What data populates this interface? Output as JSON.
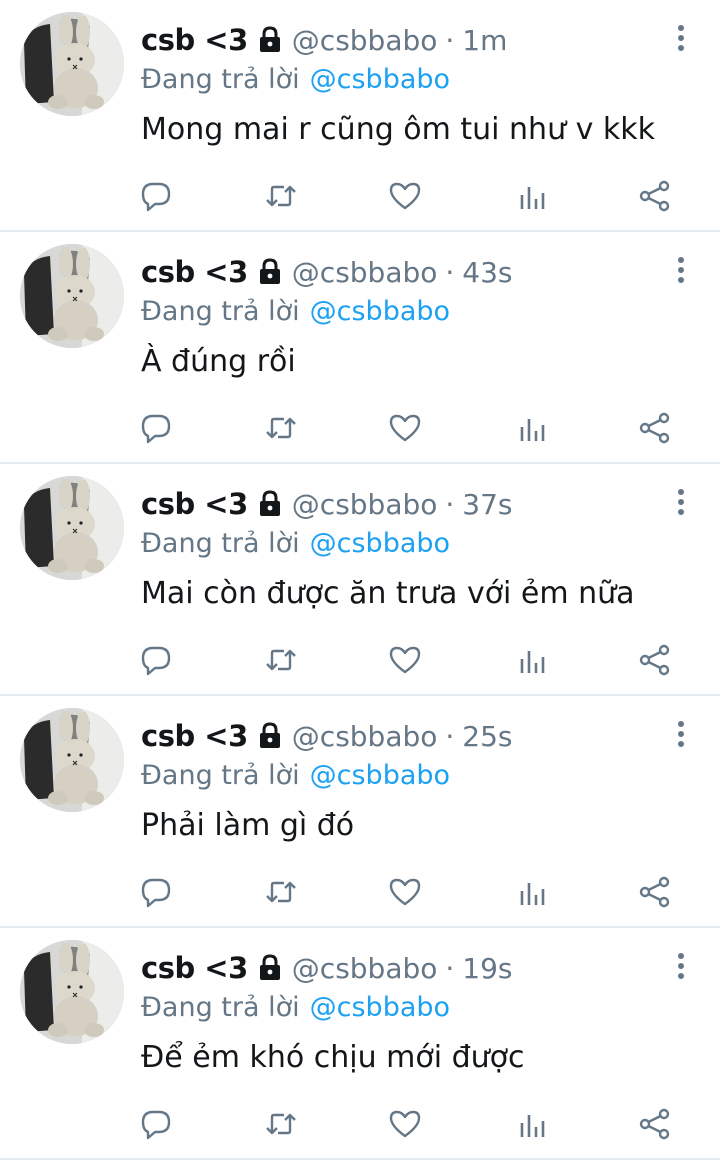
{
  "feed": {
    "tweets": [
      {
        "display_name": "csb <3",
        "handle": "@csbbabo",
        "separator": "·",
        "time": "1m",
        "reply_prefix": "Đang trả lời",
        "reply_target": "@csbbabo",
        "text": "Mong mai r cũng ôm tui như v kkk"
      },
      {
        "display_name": "csb <3",
        "handle": "@csbbabo",
        "separator": "·",
        "time": "43s",
        "reply_prefix": "Đang trả lời",
        "reply_target": "@csbbabo",
        "text": "À đúng rồi"
      },
      {
        "display_name": "csb <3",
        "handle": "@csbbabo",
        "separator": "·",
        "time": "37s",
        "reply_prefix": "Đang trả lời",
        "reply_target": "@csbbabo",
        "text": "Mai còn được ăn trưa với ẻm nữa"
      },
      {
        "display_name": "csb <3",
        "handle": "@csbbabo",
        "separator": "·",
        "time": "25s",
        "reply_prefix": "Đang trả lời",
        "reply_target": "@csbbabo",
        "text": "Phải làm gì đó"
      },
      {
        "display_name": "csb <3",
        "handle": "@csbbabo",
        "separator": "·",
        "time": "19s",
        "reply_prefix": "Đang trả lời",
        "reply_target": "@csbbabo",
        "text": "Để ẻm khó chịu mới được"
      }
    ]
  },
  "icons": {
    "avatar": "bunny-plush-avatar",
    "protected": "lock-icon",
    "more": "more-vertical-icon",
    "reply": "reply-icon",
    "retweet": "retweet-icon",
    "like": "heart-icon",
    "analytics": "analytics-icon",
    "share": "share-icon"
  },
  "colors": {
    "text_primary": "#14171a",
    "text_secondary": "#657786",
    "link": "#1da1f2",
    "icon": "#657786",
    "divider": "#e6ecf0"
  }
}
